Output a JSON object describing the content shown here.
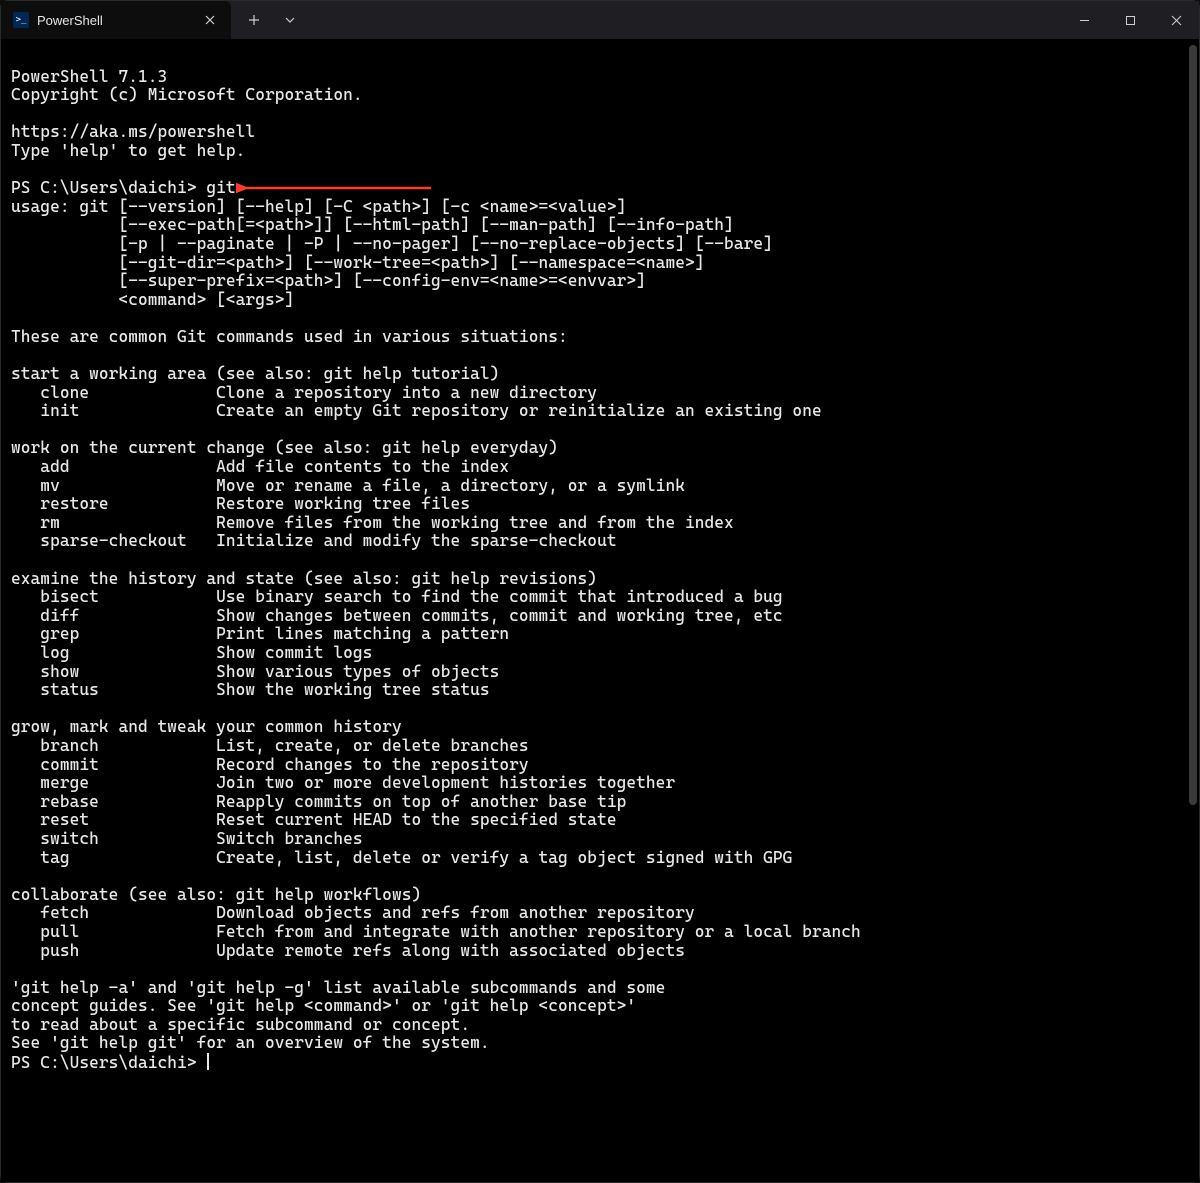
{
  "tab": {
    "title": "PowerShell",
    "icon_label": ">_"
  },
  "header": {
    "version_line": "PowerShell 7.1.3",
    "copyright": "Copyright (c) Microsoft Corporation.",
    "url": "https://aka.ms/powershell",
    "help_hint": "Type 'help' to get help."
  },
  "prompt1": {
    "prefix": "PS C:\\Users\\daichi> ",
    "command": "git"
  },
  "usage": {
    "l1": "usage: git [--version] [--help] [-C <path>] [-c <name>=<value>]",
    "l2": "           [--exec-path[=<path>]] [--html-path] [--man-path] [--info-path]",
    "l3": "           [-p | --paginate | -P | --no-pager] [--no-replace-objects] [--bare]",
    "l4": "           [--git-dir=<path>] [--work-tree=<path>] [--namespace=<name>]",
    "l5": "           [--super-prefix=<path>] [--config-env=<name>=<envvar>]",
    "l6": "           <command> [<args>]"
  },
  "sections": {
    "intro": "These are common Git commands used in various situations:",
    "start": {
      "title": "start a working area (see also: git help tutorial)",
      "rows": [
        {
          "cmd": "clone",
          "desc": "Clone a repository into a new directory"
        },
        {
          "cmd": "init",
          "desc": "Create an empty Git repository or reinitialize an existing one"
        }
      ]
    },
    "work": {
      "title": "work on the current change (see also: git help everyday)",
      "rows": [
        {
          "cmd": "add",
          "desc": "Add file contents to the index"
        },
        {
          "cmd": "mv",
          "desc": "Move or rename a file, a directory, or a symlink"
        },
        {
          "cmd": "restore",
          "desc": "Restore working tree files"
        },
        {
          "cmd": "rm",
          "desc": "Remove files from the working tree and from the index"
        },
        {
          "cmd": "sparse-checkout",
          "desc": "Initialize and modify the sparse-checkout"
        }
      ]
    },
    "examine": {
      "title": "examine the history and state (see also: git help revisions)",
      "rows": [
        {
          "cmd": "bisect",
          "desc": "Use binary search to find the commit that introduced a bug"
        },
        {
          "cmd": "diff",
          "desc": "Show changes between commits, commit and working tree, etc"
        },
        {
          "cmd": "grep",
          "desc": "Print lines matching a pattern"
        },
        {
          "cmd": "log",
          "desc": "Show commit logs"
        },
        {
          "cmd": "show",
          "desc": "Show various types of objects"
        },
        {
          "cmd": "status",
          "desc": "Show the working tree status"
        }
      ]
    },
    "grow": {
      "title": "grow, mark and tweak your common history",
      "rows": [
        {
          "cmd": "branch",
          "desc": "List, create, or delete branches"
        },
        {
          "cmd": "commit",
          "desc": "Record changes to the repository"
        },
        {
          "cmd": "merge",
          "desc": "Join two or more development histories together"
        },
        {
          "cmd": "rebase",
          "desc": "Reapply commits on top of another base tip"
        },
        {
          "cmd": "reset",
          "desc": "Reset current HEAD to the specified state"
        },
        {
          "cmd": "switch",
          "desc": "Switch branches"
        },
        {
          "cmd": "tag",
          "desc": "Create, list, delete or verify a tag object signed with GPG"
        }
      ]
    },
    "collab": {
      "title": "collaborate (see also: git help workflows)",
      "rows": [
        {
          "cmd": "fetch",
          "desc": "Download objects and refs from another repository"
        },
        {
          "cmd": "pull",
          "desc": "Fetch from and integrate with another repository or a local branch"
        },
        {
          "cmd": "push",
          "desc": "Update remote refs along with associated objects"
        }
      ]
    }
  },
  "footer": {
    "l1": "'git help -a' and 'git help -g' list available subcommands and some",
    "l2": "concept guides. See 'git help <command>' or 'git help <concept>'",
    "l3": "to read about a specific subcommand or concept.",
    "l4": "See 'git help git' for an overview of the system."
  },
  "prompt2": {
    "prefix": "PS C:\\Users\\daichi> "
  },
  "annotation": {
    "arrow_color": "#ff3b30"
  }
}
